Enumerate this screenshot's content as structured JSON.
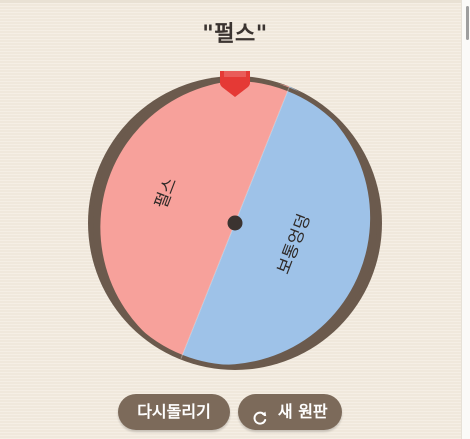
{
  "result": {
    "title": "\"펄스\""
  },
  "wheel": {
    "segments": [
      {
        "label": "펄스",
        "color": "#f7a19b"
      },
      {
        "label": "보통엉덩",
        "color": "#9ec2e8"
      }
    ],
    "rim_color": "#6b5a4d",
    "hub_color": "#3b3330",
    "pointer_color": "#e53935"
  },
  "buttons": {
    "respin_label": "다시돌리기",
    "new_label": "새 원판"
  },
  "icons": {
    "pointer": "marker-pointer-icon",
    "refresh": "refresh-icon"
  }
}
